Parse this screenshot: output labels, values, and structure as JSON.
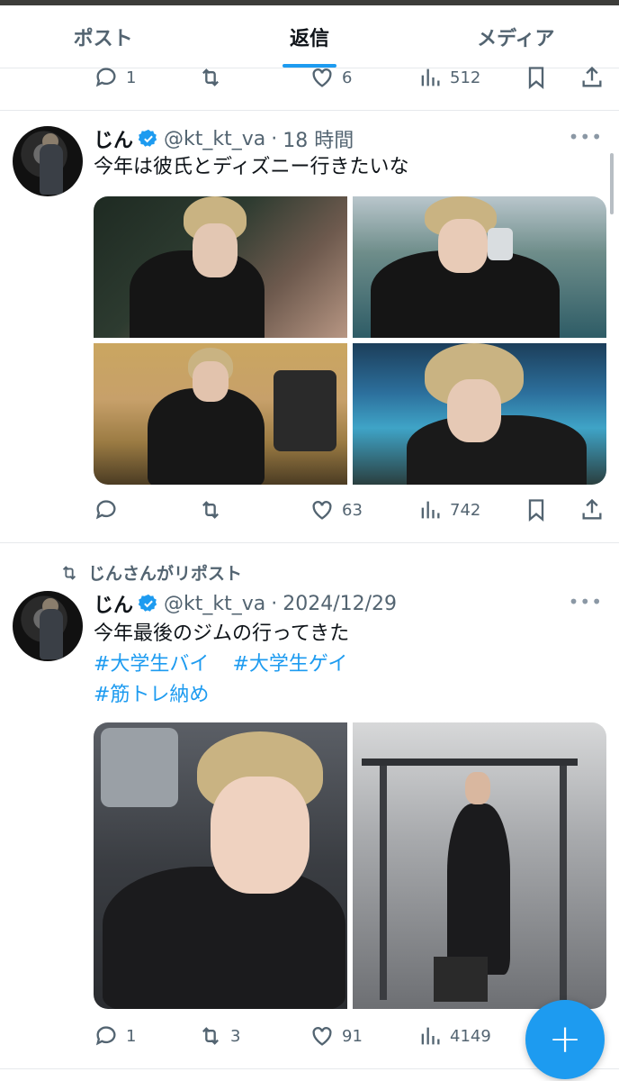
{
  "tabs": [
    {
      "label": "ポスト",
      "active": false
    },
    {
      "label": "返信",
      "active": true
    },
    {
      "label": "メディア",
      "active": false
    }
  ],
  "prev_post": {
    "replies": "1",
    "retweets": "",
    "likes": "6",
    "views": "512"
  },
  "post1": {
    "name": "じん",
    "handle": "@kt_kt_va",
    "sep": "·",
    "time": "18 時間",
    "text": "今年は彼氏とディズニー行きたいな",
    "replies": "",
    "retweets": "",
    "likes": "63",
    "views": "742"
  },
  "post2": {
    "repost_label": "じんさんがリポスト",
    "name": "じん",
    "handle": "@kt_kt_va",
    "sep": "·",
    "time": "2024/12/29",
    "text": "今年最後のジムの行ってきた",
    "hashtags": [
      "#大学生バイ",
      "#大学生ゲイ",
      "#筋トレ納め"
    ],
    "replies": "1",
    "retweets": "3",
    "likes": "91",
    "views": "4149"
  },
  "more_label": "•••",
  "fab_label": "+",
  "colors": {
    "accent": "#1d9bf0",
    "text": "#0f1419",
    "secondary": "#536471"
  }
}
